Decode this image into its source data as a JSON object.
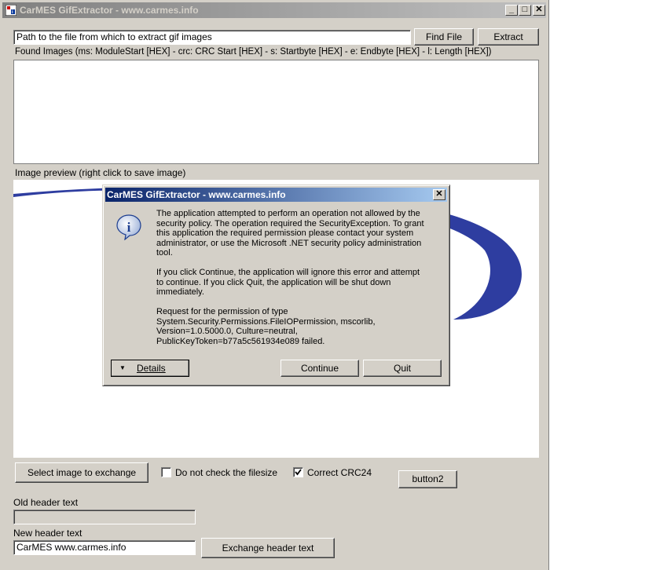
{
  "window": {
    "title": "CarMES GifExtractor - www.carmes.info",
    "minimize": "_",
    "maximize": "□",
    "close": "✕"
  },
  "file": {
    "path_value": "Path to the file from which to extract gif images",
    "find_label": "Find File",
    "extract_label": "Extract"
  },
  "found_label": "Found Images (ms: ModuleStart [HEX]   - crc: CRC Start [HEX]  - s: Startbyte [HEX]   - e: Endbyte [HEX]   - l: Length [HEX])",
  "preview_label": "Image preview (right click to save image)",
  "controls": {
    "select_image_label": "Select image to exchange",
    "no_check_label": "Do not check the filesize",
    "no_check_checked": false,
    "correct_crc_label": "Correct CRC24",
    "correct_crc_checked": true,
    "button2_label": "button2"
  },
  "header": {
    "old_label": "Old header text",
    "old_value": "",
    "new_label": "New header text",
    "new_value": "CarMES  www.carmes.info",
    "exchange_label": "Exchange header text"
  },
  "dialog": {
    "title": "CarMES GifExtractor - www.carmes.info",
    "close": "✕",
    "icon_glyph": "i",
    "para1": "The application attempted to perform an operation not allowed by the security policy. The operation required the SecurityException. To grant this application the required permission please contact your system administrator, or use the Microsoft .NET security policy administration tool.",
    "para2": "If you click Continue, the application will ignore this error and attempt to continue. If you click Quit, the application will be shut down immediately.",
    "para3": "Request for the permission of type System.Security.Permissions.FileIOPermission, mscorlib, Version=1.0.5000.0, Culture=neutral, PublicKeyToken=b77a5c561934e089 failed.",
    "details_label": "Details",
    "continue_label": "Continue",
    "quit_label": "Quit"
  },
  "colors": {
    "face": "#d4d0c8",
    "active_title": "#0a246a",
    "inactive_title": "#808080",
    "logo_blue": "#2e3da0"
  }
}
